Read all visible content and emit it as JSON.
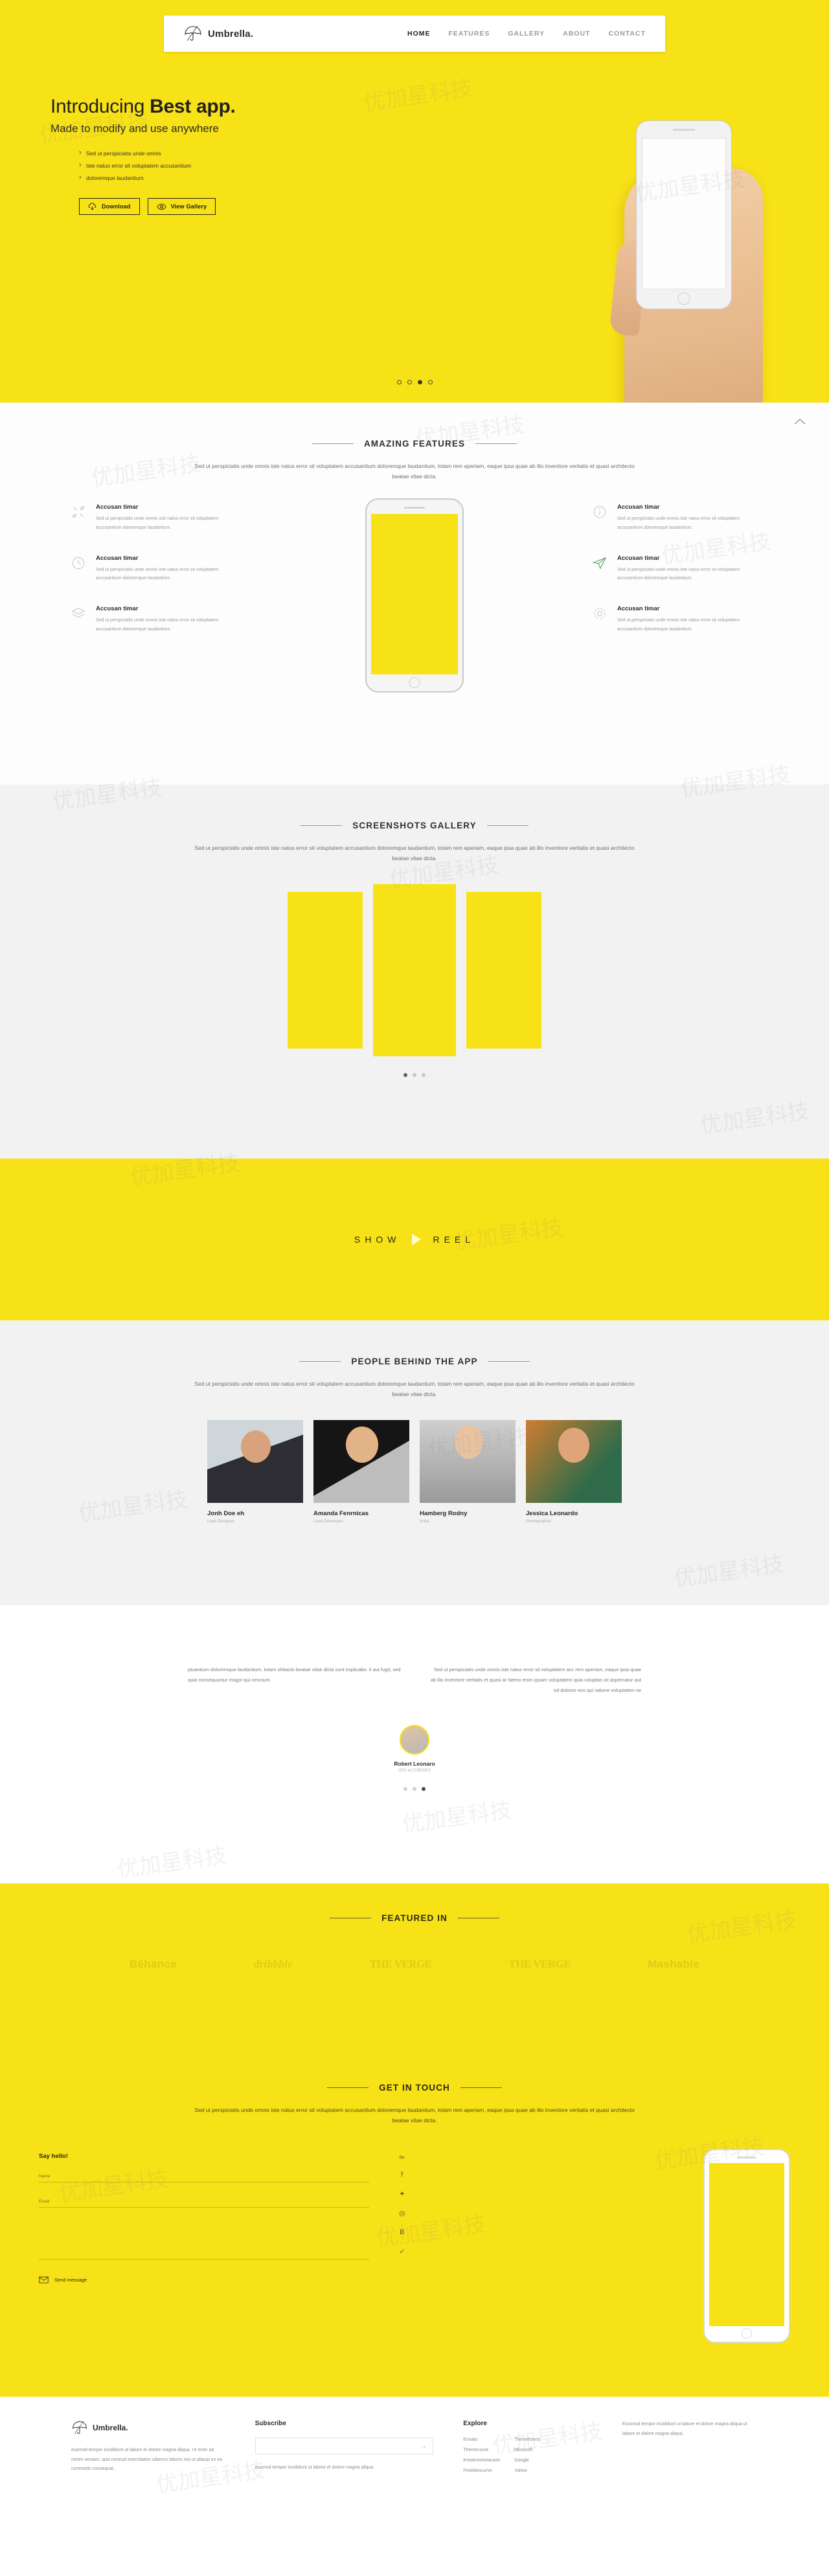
{
  "brand": {
    "name": "Umbrella.",
    "icon": "umbrella-icon"
  },
  "nav": {
    "items": [
      {
        "label": "HOME",
        "active": true
      },
      {
        "label": "FEATURES",
        "active": false
      },
      {
        "label": "GALLERY",
        "active": false
      },
      {
        "label": "ABOUT",
        "active": false
      },
      {
        "label": "CONTACT",
        "active": false
      }
    ]
  },
  "hero": {
    "title_regular": "Introducing ",
    "title_bold": "Best app.",
    "subtitle": "Made to modify and use anywhere",
    "bullets": [
      "Sed ut perspiciatis unde omnis",
      "Iste natus error sit voluptatem accusantium",
      "doloremque laudantium"
    ],
    "buttons": [
      {
        "label": "Download",
        "icon": "cloud-download-icon"
      },
      {
        "label": "View Gallery",
        "icon": "eye-icon"
      }
    ],
    "slider_dots": 4,
    "slider_active_index": 2
  },
  "features": {
    "title": "AMAZING FEATURES",
    "subtitle": "Sed ut perspiciatis unde omnis iste natus error sit voluptatem accusantium doloremque laudantium, totam rem aperiam, eaque ipsa quae ab illo inventore veritatis et quasi architecto beatae vitae dicta.",
    "body": "Sed ut perspiciatis unde omnis iste natus error sit voluptatem accusantium doloremque laudantium.",
    "left": [
      {
        "title": "Accusan timar",
        "icon": "tools-icon"
      },
      {
        "title": "Accusan timar",
        "icon": "clock-icon"
      },
      {
        "title": "Accusan timar",
        "icon": "layers-icon"
      }
    ],
    "right": [
      {
        "title": "Accusan timar",
        "icon": "info-icon"
      },
      {
        "title": "Accusan timar",
        "icon": "paper-plane-icon"
      },
      {
        "title": "Accusan timar",
        "icon": "gear-icon"
      }
    ],
    "scroll_top_icon": "chevron-up-icon"
  },
  "gallery": {
    "title": "SCREENSHOTS GALLERY",
    "subtitle": "Sed ut perspiciatis unde omnis iste natus error sit voluptatem accusantium doloremque laudantium, totam rem aperiam, eaque ipsa quae ab illo inventore veritatis et quasi architecto beatae vitae dicta.",
    "dots": 3,
    "active_index": 0
  },
  "reel": {
    "left": "SHOW",
    "right": "REEL",
    "icon": "play-icon"
  },
  "team": {
    "title": "PEOPLE BEHIND THE APP",
    "subtitle": "Sed ut perspiciatis unde omnis iste natus error sit voluptatem accusantium doloremque laudantium, totam rem aperiam, eaque ipsa quae ab illo inventore veritatis et quasi architecto beatae vitae dicta.",
    "members": [
      {
        "name": "Jonh Doe eh",
        "role": "Lead Designer"
      },
      {
        "name": "Amanda Fenrnicas",
        "role": "Lead Developer"
      },
      {
        "name": "Hamberg Rodny",
        "role": "Artist"
      },
      {
        "name": "Jessica Leonardo",
        "role": "Photographer"
      }
    ]
  },
  "testimonial": {
    "left_text": "ptuantium doloremque laudantium, totam ohitacto beatae vitae dicta sunt explicabo. it aut fugit, sed quia consequuntur magni qui nesciunt.",
    "right_text": "Sed ut perspiciatis unde omnis iste natus error sit voluptatem acc rem aperiam, eaque ipsa quae ab illo inventore veritatis et quasi ar Nemo enim ipsam voluptatem quia voluptas sit aspernatur aut od dolores eos qui ratione voluptatem se",
    "author": "Robert Leonaro",
    "role": "CEO at CUBEDES",
    "dots": 3,
    "active_index": 2
  },
  "featured": {
    "title": "FEATURED IN",
    "brands": [
      "Bēhance",
      "dribbble",
      "THE VERGE",
      "THE VERGE",
      "Mashable"
    ]
  },
  "contact": {
    "title": "GET IN TOUCH",
    "subtitle": "Sed ut perspiciatis unde omnis iste natus error sit voluptatem accusantium doloremque laudantium, totam rem aperiam, eaque ipsa quae ab illo inventore veritatis et quasi architecto beatae vitae dicta.",
    "form_title": "Say hello!",
    "fields": [
      {
        "label": "Name",
        "value": ""
      },
      {
        "label": "Email",
        "value": ""
      },
      {
        "label": "",
        "value": ""
      }
    ],
    "send_label": "Send message",
    "send_icon": "envelope-icon",
    "socials_header": "Be",
    "socials": [
      "facebook-icon",
      "twitter-icon",
      "dribbble-icon",
      "behance-icon",
      "pinterest-icon"
    ]
  },
  "footer": {
    "brand": "Umbrella.",
    "about": "eusmod tempor incididunt ut labore et dolore magna aliqua. Ut enim ad minim veniam, quis nostrud exercitation ullamco laboris nisi ut aliquip ex ea commodo consequat.",
    "subscribe_title": "Subscribe",
    "subscribe_placeholder": "",
    "subscribe_arrow": "arrow-right-icon",
    "subscribe_note": "eusmod tempor incididunt ut labore et dolore magna aliqua.",
    "explore_title": "Explore",
    "explore_col1": [
      "Envato",
      "Themecurve",
      "Kreativeshowcase",
      "Freebiescurve"
    ],
    "explore_col2": [
      "Themeforest",
      "Microsoft",
      "Google",
      "Yahoo"
    ],
    "last_text": "Eiusmod tempor incididunt ut labore et dolore magna aliqua ut labore et dolore magna aliqua."
  }
}
